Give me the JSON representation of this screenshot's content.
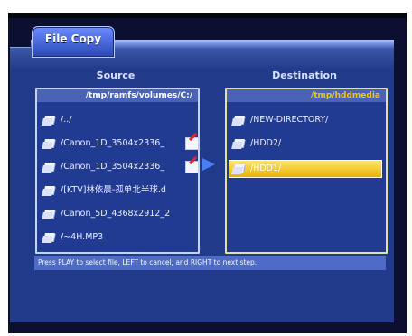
{
  "dialog": {
    "tab_label": "File Copy",
    "hint": "Press PLAY to select file, LEFT to cancel, and RIGHT to next step."
  },
  "source": {
    "title": "Source",
    "path": "/tmp/ramfs/volumes/C:/",
    "items": [
      {
        "label": "/../",
        "checked": false
      },
      {
        "label": "/Canon_1D_3504x2336_",
        "checked": true
      },
      {
        "label": "/Canon_1D_3504x2336_",
        "checked": true
      },
      {
        "label": "/[KTV]林依晨-孤单北半球.d",
        "checked": false
      },
      {
        "label": "/Canon_5D_4368x2912_2",
        "checked": false
      },
      {
        "label": "/~4H.MP3",
        "checked": false
      }
    ]
  },
  "destination": {
    "title": "Destination",
    "path": "/tmp/hddmedia",
    "items": [
      {
        "label": "/NEW-DIRECTORY/"
      },
      {
        "label": "/HDD2/"
      },
      {
        "label": "/HDD1/",
        "selected": true
      }
    ]
  },
  "colors": {
    "panel": "#223a8a",
    "path_text_destination": "#f2c800",
    "selection": "#e6b300",
    "check_mark": "#e6262c"
  }
}
